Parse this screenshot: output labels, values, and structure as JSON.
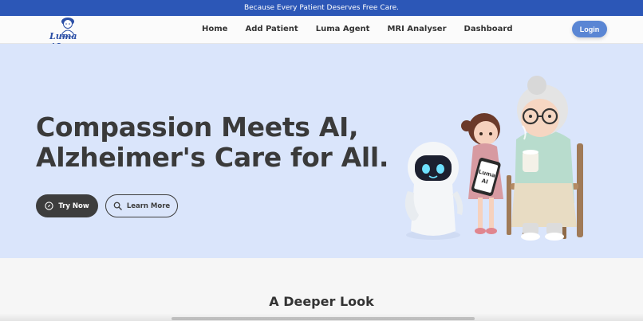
{
  "announcement": "Because Every Patient Deserves Free Care.",
  "brand": {
    "logo_text": "Luma AI"
  },
  "nav": {
    "links": [
      "Home",
      "Add Patient",
      "Luma Agent",
      "MRI Analyser",
      "Dashboard"
    ],
    "login_label": "Login"
  },
  "hero": {
    "title_line1": "Compassion Meets AI,",
    "title_line2": "Alzheimer's Care for All.",
    "try_label": "Try Now",
    "learn_label": "Learn More",
    "tablet_text": "Luma AI"
  },
  "section": {
    "title": "A Deeper Look"
  },
  "colors": {
    "announce_bg": "#2c57b7",
    "hero_bg": "#dae5fb",
    "login_bg": "#5a86d4",
    "primary_dark": "#3d3d3d"
  },
  "icons": {
    "try": "compass-icon",
    "learn": "search-icon"
  }
}
